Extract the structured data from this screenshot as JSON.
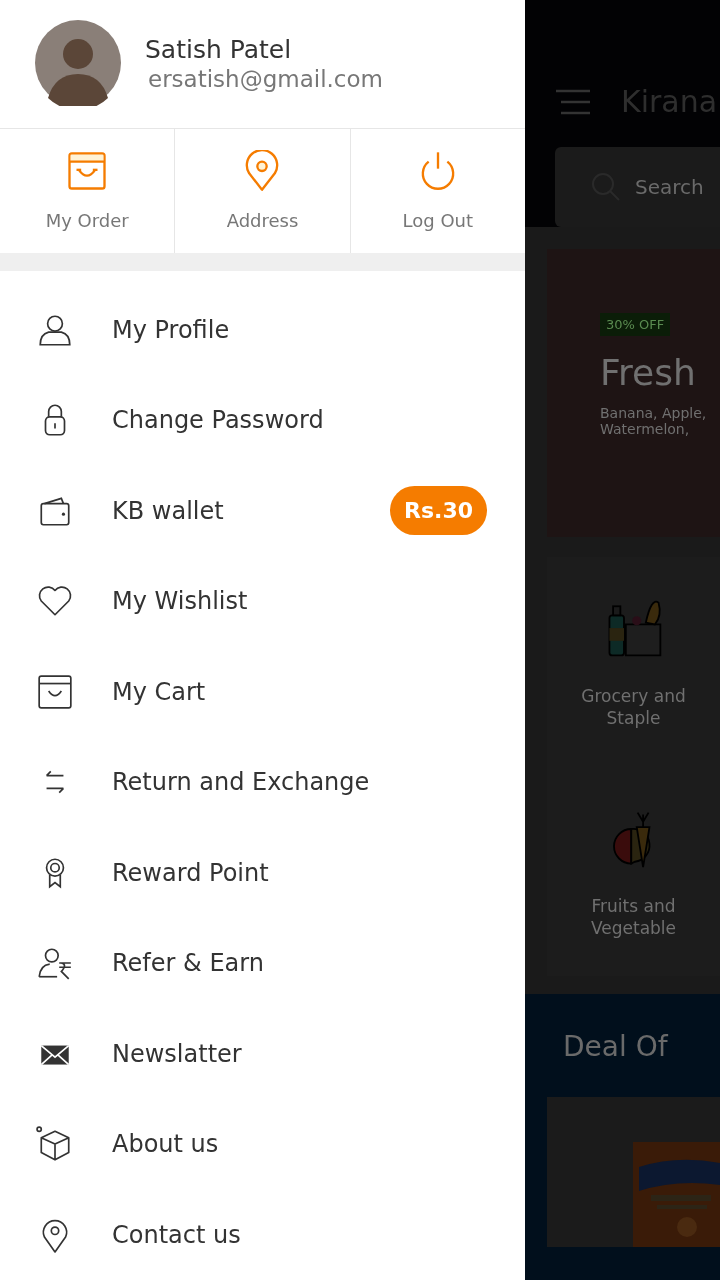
{
  "drawer": {
    "user": {
      "name": "Satish Patel",
      "email": "ersatish@gmail.com"
    },
    "shortcuts": [
      {
        "label": "My Order"
      },
      {
        "label": "Address"
      },
      {
        "label": "Log Out"
      }
    ],
    "menu": [
      {
        "label": "My Profile"
      },
      {
        "label": "Change Password"
      },
      {
        "label": "KB wallet",
        "badge": "Rs.30"
      },
      {
        "label": "My Wishlist"
      },
      {
        "label": "My Cart"
      },
      {
        "label": "Return and Exchange"
      },
      {
        "label": "Reward Point"
      },
      {
        "label": "Refer & Earn"
      },
      {
        "label": "Newslatter"
      },
      {
        "label": "About us"
      },
      {
        "label": "Contact us"
      }
    ]
  },
  "background_app": {
    "title": "Kirana",
    "search": {
      "placeholder": "Search"
    },
    "banner": {
      "badge": "30% OFF",
      "title": "Fresh",
      "lines": [
        "Banana, Apple,",
        "Watermelon,"
      ]
    },
    "categories": [
      {
        "label": "Grocery and Staple"
      },
      {
        "label": "Fruits and Vegetable"
      }
    ],
    "deal": {
      "title": "Deal Of"
    }
  }
}
